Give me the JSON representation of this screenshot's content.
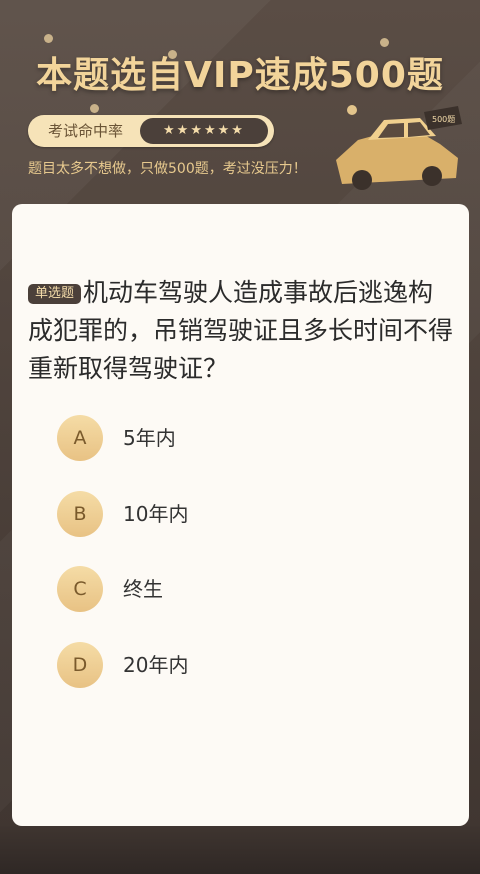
{
  "header": {
    "title": "本题选自VIP速成500题",
    "rate_label": "考试命中率",
    "stars": "★★★★★★",
    "slogan": "题目太多不想做，只做500题，考过没压力！",
    "car_badge": "500题"
  },
  "question": {
    "type_tag": "单选题",
    "text": "机动车驾驶人造成事故后逃逸构成犯罪的，吊销驾驶证且多长时间不得重新取得驾驶证？"
  },
  "options": [
    {
      "letter": "A",
      "text": "5年内"
    },
    {
      "letter": "B",
      "text": "10年内"
    },
    {
      "letter": "C",
      "text": "终生"
    },
    {
      "letter": "D",
      "text": "20年内"
    }
  ],
  "colors": {
    "background": "#4a3f39",
    "gold": "#f2d49a",
    "card": "#fdfaf5",
    "option_circle": "#f0d094"
  }
}
